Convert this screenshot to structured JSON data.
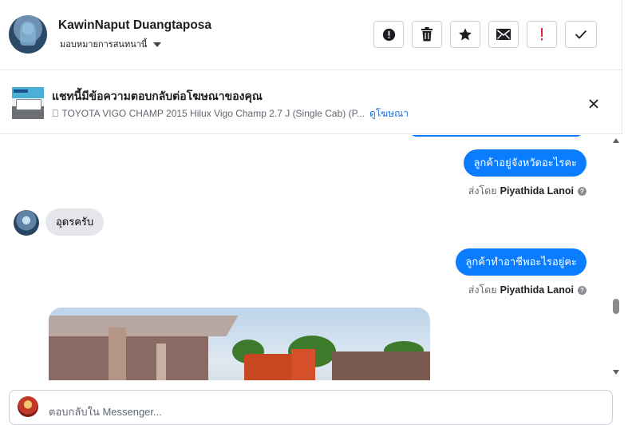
{
  "header": {
    "contact_name": "KawinNaput Duangtaposa",
    "assign_label": "มอบหมายการสนทนานี้",
    "tools": [
      {
        "name": "spam",
        "icon": "alert-circle-icon"
      },
      {
        "name": "delete",
        "icon": "trash-icon"
      },
      {
        "name": "star",
        "icon": "star-icon"
      },
      {
        "name": "mark-unread",
        "icon": "envelope-icon"
      },
      {
        "name": "follow-up",
        "icon": "exclamation-icon"
      },
      {
        "name": "done",
        "icon": "checkmark-icon"
      }
    ]
  },
  "ad_banner": {
    "title": "แชทนี้มีข้อความตอบกลับต่อโฆษณาของคุณ",
    "subtitle": "󰀀 TOYOTA VIGO CHAMP 2015 Hilux Vigo Champ 2.7 J (Single Cab) (P...",
    "link_label": "ดูโฆษณา"
  },
  "messages": [
    {
      "direction": "out",
      "text": "ลูกค้าอยู่จังหวัดอะไรคะ",
      "sent_by_label": "ส่งโดย",
      "sender": "Piyathida Lanoi"
    },
    {
      "direction": "in",
      "text": "อุดรครับ"
    },
    {
      "direction": "out",
      "text": "ลูกค้าทำอาชีพอะไรอยู่คะ",
      "sent_by_label": "ส่งโดย",
      "sender": "Piyathida Lanoi"
    }
  ],
  "composer": {
    "placeholder": "ตอบกลับใน Messenger..."
  },
  "colors": {
    "accent": "#0a7cff",
    "link": "#216fdb",
    "follow_up": "#e41e3f",
    "incoming_bubble": "#e4e6eb"
  }
}
